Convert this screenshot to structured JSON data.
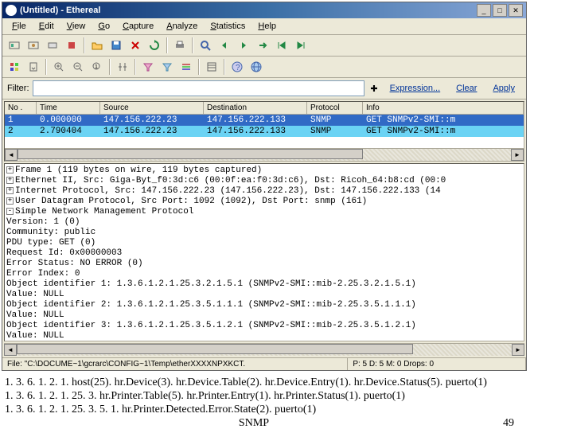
{
  "window": {
    "title": "(Untitled) - Ethereal"
  },
  "menu": {
    "file": "File",
    "edit": "Edit",
    "view": "View",
    "go": "Go",
    "capture": "Capture",
    "analyze": "Analyze",
    "statistics": "Statistics",
    "help": "Help"
  },
  "filter": {
    "label": "Filter:",
    "value": "",
    "expression": "Expression...",
    "clear": "Clear",
    "apply": "Apply"
  },
  "columns": {
    "no": "No .",
    "time": "Time",
    "source": "Source",
    "dest": "Destination",
    "proto": "Protocol",
    "info": "Info"
  },
  "rows": [
    {
      "no": "1",
      "time": "0.000000",
      "src": "147.156.222.23",
      "dst": "147.156.222.133",
      "proto": "SNMP",
      "info": "GET SNMPv2-SMI::m"
    },
    {
      "no": "2",
      "time": "2.790404",
      "src": "147.156.222.23",
      "dst": "147.156.222.133",
      "proto": "SNMP",
      "info": "GET SNMPv2-SMI::m"
    }
  ],
  "details": [
    "Frame 1 (119 bytes on wire, 119 bytes captured)",
    "Ethernet II, Src: Giga-Byt_f0:3d:c6 (00:0f:ea:f0:3d:c6), Dst: Ricoh_64:b8:cd (00:0",
    "Internet Protocol, Src: 147.156.222.23 (147.156.222.23), Dst: 147.156.222.133 (14",
    "User Datagram Protocol, Src Port: 1092 (1092), Dst Port: snmp (161)",
    "Simple Network Management Protocol",
    "    Version: 1 (0)",
    "    Community: public",
    "    PDU type: GET (0)",
    "    Request Id: 0x00000003",
    "    Error Status: NO ERROR (0)",
    "    Error Index: 0",
    "    Object identifier 1: 1.3.6.1.2.1.25.3.2.1.5.1 (SNMPv2-SMI::mib-2.25.3.2.1.5.1)",
    "    Value: NULL",
    "    Object identifier 2: 1.3.6.1.2.1.25.3.5.1.1.1 (SNMPv2-SMI::mib-2.25.3.5.1.1.1)",
    "    Value: NULL",
    "    Object identifier 3: 1.3.6.1.2.1.25.3.5.1.2.1 (SNMPv2-SMI::mib-2.25.3.5.1.2.1)",
    "    Value: NULL"
  ],
  "details_box": [
    "+",
    "+",
    "+",
    "+",
    "-"
  ],
  "status": {
    "file": "File: \"C:\\DOCUME~1\\gcrarc\\CONFIG~1\\Temp\\etherXXXXNPXKCT.",
    "pkts": "P: 5 D: 5 M: 0 Drops: 0"
  },
  "footer": {
    "l1": "1. 3. 6. 1. 2. 1. host(25). hr.Device(3). hr.Device.Table(2). hr.Device.Entry(1). hr.Device.Status(5). puerto(1)",
    "l2": "1. 3. 6. 1. 2. 1. 25. 3. hr.Printer.Table(5). hr.Printer.Entry(1). hr.Printer.Status(1). puerto(1)",
    "l3": "1. 3. 6. 1. 2. 1. 25. 3. 5. 1. hr.Printer.Detected.Error.State(2). puerto(1)",
    "proto": "SNMP",
    "page": "49"
  }
}
